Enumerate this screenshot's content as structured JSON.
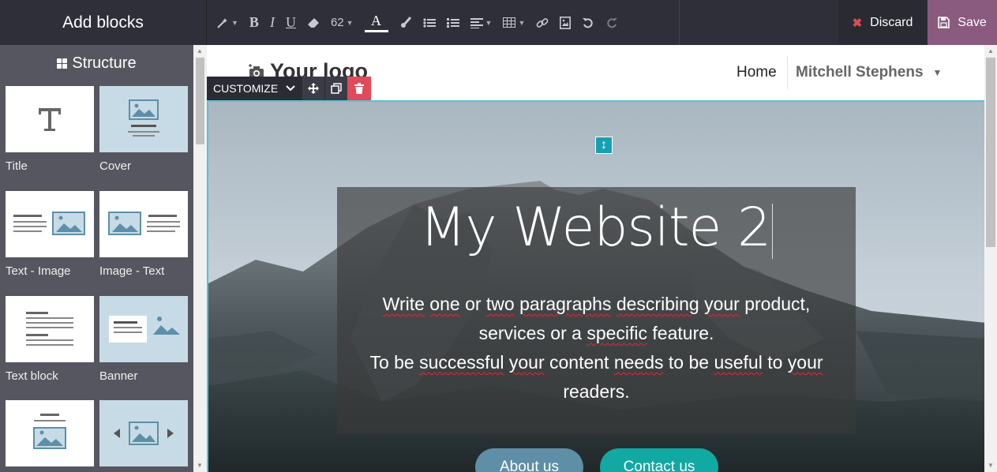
{
  "topbar": {
    "add_blocks_title": "Add blocks",
    "font_size": "62",
    "discard_label": "Discard",
    "save_label": "Save"
  },
  "sidebar": {
    "section_title": "Structure",
    "blocks": [
      {
        "label": "Title"
      },
      {
        "label": "Cover"
      },
      {
        "label": "Text - Image"
      },
      {
        "label": "Image - Text"
      },
      {
        "label": "Text block"
      },
      {
        "label": "Banner"
      }
    ]
  },
  "site": {
    "logo_text": "Your logo",
    "nav_home": "Home",
    "nav_user": "Mitchell Stephens"
  },
  "customize": {
    "label": "CUSTOMIZE"
  },
  "hero": {
    "title": "My Website 2",
    "text_line1_a": "Write",
    "text_line1_b": "one",
    "text_line1_c": "or",
    "text_line1_d": "two",
    "text_line1_e": "paragraphs",
    "text_line1_f": "describing",
    "text_line1_g": "your",
    "text_line1_h": "product,",
    "text_line2_a": "services or a",
    "text_line2_b": "specific",
    "text_line2_c": "feature.",
    "text_line3_a": "To be",
    "text_line3_b": "successful",
    "text_line3_c": "your",
    "text_line3_d": "content",
    "text_line3_e": "needs",
    "text_line3_f": "to be",
    "text_line3_g": "useful",
    "text_line3_h": "to",
    "text_line3_i": "your",
    "text_line4": "readers.",
    "btn_about": "About us",
    "btn_contact": "Contact us"
  },
  "colors": {
    "topbar_bg": "#2f2f3a",
    "save_bg": "#8a5a7f",
    "discard_icon": "#e2495a",
    "sidebar_bg": "#565660",
    "thumb_blue": "#c7dbe6",
    "accent_teal": "#11a9a2",
    "about_btn": "#5f8fa6",
    "selection_border": "#5dbfd1"
  }
}
